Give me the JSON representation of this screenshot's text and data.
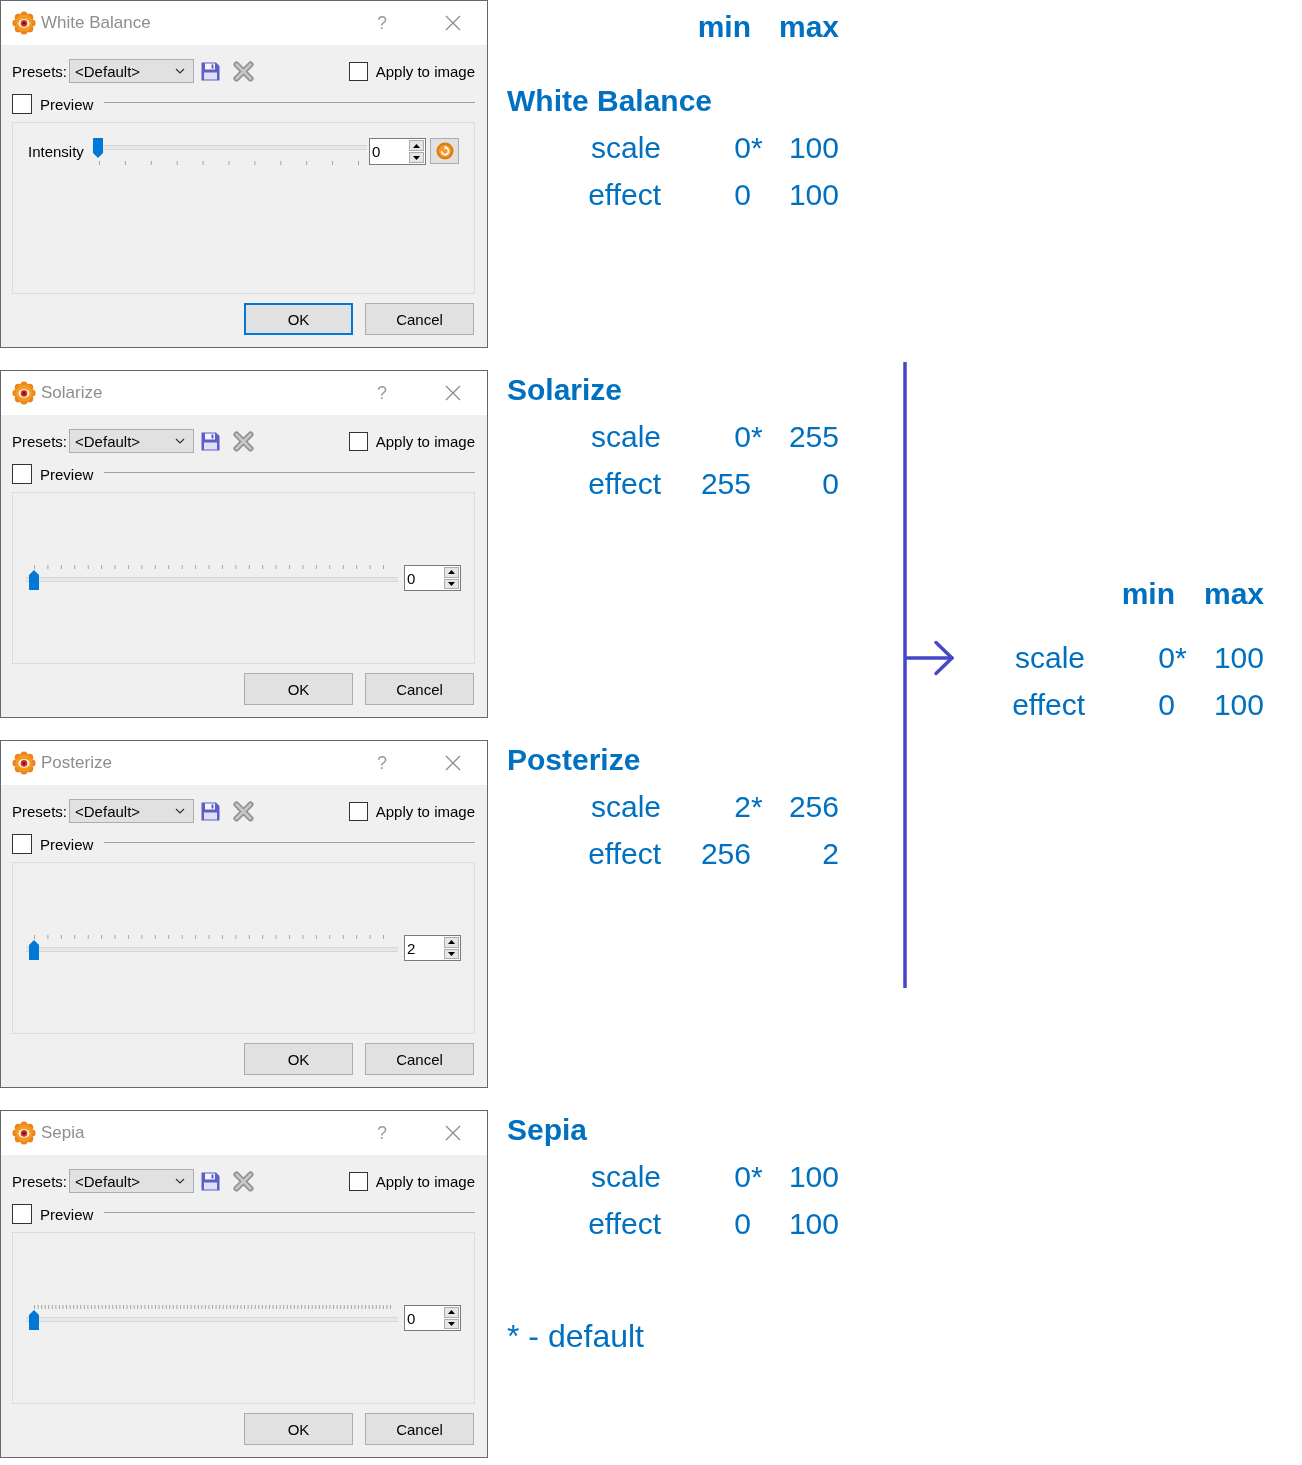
{
  "header": {
    "columns": [
      "min",
      "max"
    ]
  },
  "filters": [
    {
      "dialog": {
        "title": "White Balance",
        "help": "?",
        "presets": {
          "label": "Presets:",
          "value": "<Default>"
        },
        "apply": {
          "label": "Apply to image",
          "checked": false
        },
        "preview": {
          "label": "Preview",
          "checked": false
        },
        "slider": {
          "kind": "labeled",
          "label": "Intensity",
          "level": 0,
          "value": "0"
        },
        "buttons": [
          {
            "label": "OK",
            "focused": true
          },
          {
            "label": "Cancel",
            "focused": false
          }
        ]
      },
      "ranges": {
        "title": "White Balance",
        "rows": [
          {
            "label": "scale",
            "min": "0",
            "mark": "*",
            "max": "100"
          },
          {
            "label": "effect",
            "min": "0",
            "max": "100"
          }
        ]
      }
    },
    {
      "dialog": {
        "title": "Solarize",
        "help": "?",
        "presets": {
          "label": "Presets:",
          "value": "<Default>"
        },
        "apply": {
          "label": "Apply to image",
          "checked": false
        },
        "preview": {
          "label": "Preview",
          "checked": false
        },
        "slider": {
          "kind": "coarse",
          "level": 0,
          "value": "0"
        },
        "buttons": [
          {
            "label": "OK",
            "focused": false
          },
          {
            "label": "Cancel",
            "focused": false
          }
        ]
      },
      "ranges": {
        "title": "Solarize",
        "rows": [
          {
            "label": "scale",
            "min": "0",
            "mark": "*",
            "max": "255"
          },
          {
            "label": "effect",
            "min": "255",
            "max": "0"
          }
        ]
      }
    },
    {
      "dialog": {
        "title": "Posterize",
        "help": "?",
        "presets": {
          "label": "Presets:",
          "value": "<Default>"
        },
        "apply": {
          "label": "Apply to image",
          "checked": false
        },
        "preview": {
          "label": "Preview",
          "checked": false
        },
        "slider": {
          "kind": "coarse",
          "level": 0,
          "value": "2"
        },
        "buttons": [
          {
            "label": "OK",
            "focused": false
          },
          {
            "label": "Cancel",
            "focused": false
          }
        ]
      },
      "ranges": {
        "title": "Posterize",
        "rows": [
          {
            "label": "scale",
            "min": "2",
            "mark": "*",
            "max": "256"
          },
          {
            "label": "effect",
            "min": "256",
            "max": "2"
          }
        ]
      }
    },
    {
      "dialog": {
        "title": "Sepia",
        "help": "?",
        "presets": {
          "label": "Presets:",
          "value": "<Default>"
        },
        "apply": {
          "label": "Apply to image",
          "checked": false
        },
        "preview": {
          "label": "Preview",
          "checked": false
        },
        "slider": {
          "kind": "fine",
          "level": 0,
          "value": "0"
        },
        "buttons": [
          {
            "label": "OK",
            "focused": false
          },
          {
            "label": "Cancel",
            "focused": false
          }
        ]
      },
      "ranges": {
        "title": "Sepia",
        "rows": [
          {
            "label": "scale",
            "min": "0",
            "mark": "*",
            "max": "100"
          },
          {
            "label": "effect",
            "min": "0",
            "max": "100"
          }
        ]
      }
    }
  ],
  "legend": "* - default",
  "summary": {
    "columns": [
      "min",
      "max"
    ],
    "rows": [
      {
        "label": "scale",
        "min": "0",
        "mark": "*",
        "max": "100"
      },
      {
        "label": "effect",
        "min": "0",
        "max": "100"
      }
    ]
  }
}
